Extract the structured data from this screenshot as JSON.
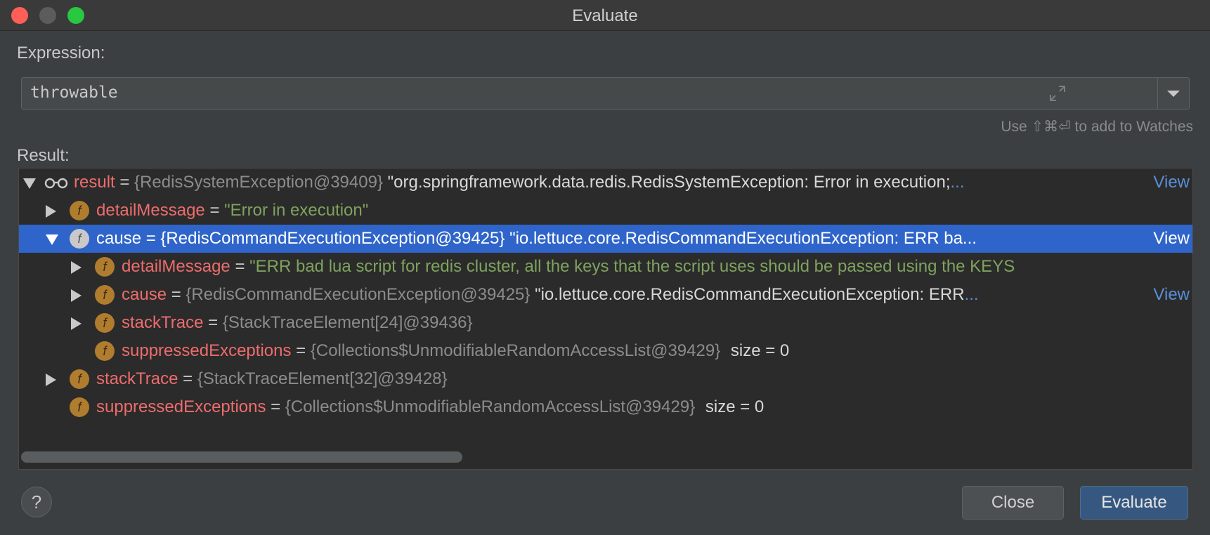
{
  "window": {
    "title": "Evaluate"
  },
  "expression": {
    "label": "Expression:",
    "value": "throwable"
  },
  "hint": "Use ⇧⌘⏎ to add to Watches",
  "result": {
    "label": "Result:",
    "rows": [
      {
        "name": "result",
        "eq": "=",
        "type": "{RedisSystemException@39409}",
        "value": "\"org.springframework.data.redis.RedisSystemException: Error in execution;",
        "ellipsis": "...",
        "view": "View"
      },
      {
        "name": "detailMessage",
        "eq": "=",
        "value": "\"Error in execution\""
      },
      {
        "name": "cause",
        "eq": "=",
        "type": "{RedisCommandExecutionException@39425}",
        "value": "\"io.lettuce.core.RedisCommandExecutionException: ERR ba",
        "ellipsis": "...",
        "view": "View"
      },
      {
        "name": "detailMessage",
        "eq": "=",
        "value": "\"ERR bad lua script for redis cluster, all the keys that the script uses should be passed using the KEYS"
      },
      {
        "name": "cause",
        "eq": "=",
        "type": "{RedisCommandExecutionException@39425}",
        "value": "\"io.lettuce.core.RedisCommandExecutionException: ERR",
        "ellipsis": "...",
        "view": "View"
      },
      {
        "name": "stackTrace",
        "eq": "=",
        "type": "{StackTraceElement[24]@39436}"
      },
      {
        "name": "suppressedExceptions",
        "eq": "=",
        "type": "{Collections$UnmodifiableRandomAccessList@39429}",
        "size": "size = 0"
      },
      {
        "name": "stackTrace",
        "eq": "=",
        "type": "{StackTraceElement[32]@39428}"
      },
      {
        "name": "suppressedExceptions",
        "eq": "=",
        "type": "{Collections$UnmodifiableRandomAccessList@39429}",
        "size": "size = 0"
      }
    ]
  },
  "buttons": {
    "help": "?",
    "close": "Close",
    "evaluate": "Evaluate"
  },
  "icons": {
    "field": "f"
  }
}
